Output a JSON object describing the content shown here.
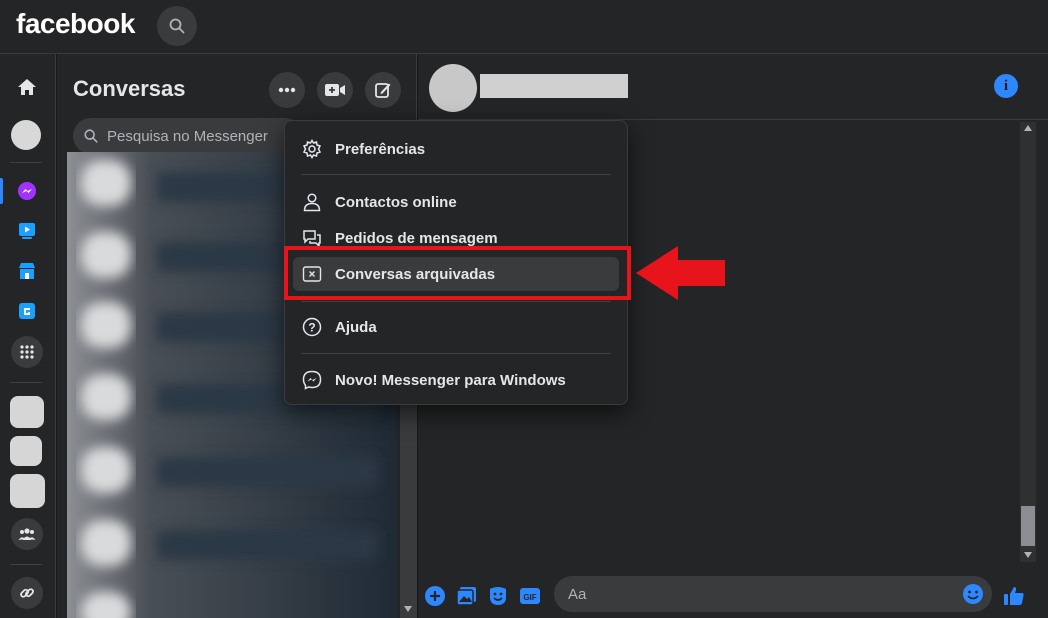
{
  "brand": {
    "logo_text": "facebook"
  },
  "chat_list": {
    "title": "Conversas",
    "search_placeholder": "Pesquisa no Messenger"
  },
  "menu": {
    "items": [
      {
        "label": "Preferências",
        "icon": "gear-icon"
      },
      {
        "label": "Contactos online",
        "icon": "person-icon"
      },
      {
        "label": "Pedidos de mensagem",
        "icon": "chat-bubbles-icon"
      },
      {
        "label": "Conversas arquivadas",
        "icon": "archive-box-icon",
        "highlighted": true
      },
      {
        "label": "Ajuda",
        "icon": "question-circle-icon"
      },
      {
        "label": "Novo! Messenger para Windows",
        "icon": "messenger-icon"
      }
    ]
  },
  "composer": {
    "placeholder": "Aa"
  },
  "conversation": {
    "info_label": "i"
  },
  "colors": {
    "accent": "#2d88ff",
    "highlight_red": "#e8141b",
    "background": "#242526"
  }
}
